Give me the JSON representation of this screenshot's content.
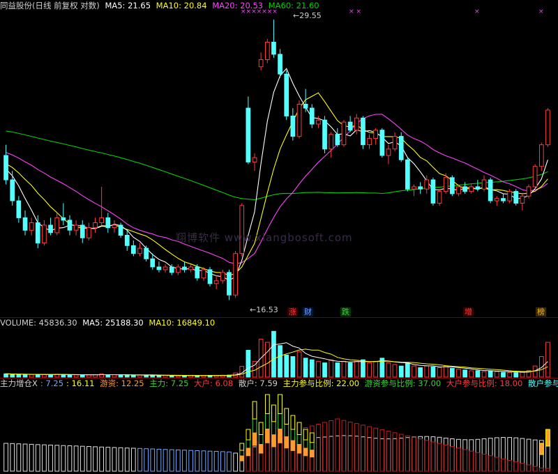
{
  "price_header": {
    "title": "同益股份(日线 前复权 对数)",
    "ma5": "MA5: 21.65",
    "ma10": "MA10: 20.84",
    "ma20": "MA20: 20.53",
    "ma60": "MA60: 21.60"
  },
  "price_labels": {
    "high": "29.55",
    "low": "16.53"
  },
  "x_marks": "×××××××",
  "event_markers": [
    {
      "text": "涨",
      "color": "#ff3b3b",
      "bg": "#3a0000"
    },
    {
      "text": "财",
      "color": "#6fa8ff",
      "bg": "#00153a"
    },
    {
      "text": "跌",
      "color": "#3bd13b",
      "bg": "#003a00"
    },
    {
      "text": "增",
      "color": "#ff3b3b",
      "bg": "#3a0000"
    },
    {
      "text": "榜",
      "color": "#ffb000",
      "bg": "#3a2a00"
    }
  ],
  "watermark": "翔博软件 www.xiangbosoft.com",
  "volume_header": {
    "volume": "VOLUME: 45836.30",
    "ma5": "MA5: 25188.30",
    "ma10": "MA10: 16849.10"
  },
  "flow_header": {
    "main_label": "主力增仓X",
    "v1": ": 7.25",
    "v2": ": 16.11",
    "youzi": "游资: 12.25",
    "zhuli": "主力: 7.25",
    "dahu": "大户: 6.08",
    "sanhu": "散户: 7.59",
    "zhuli_ratio": "主力参与比例: 22.00",
    "youzi_ratio": "游资参与比例: 37.00",
    "dahu_ratio": "大户参与比例: 18.00",
    "sanhu_ratio": "散户参与比例:"
  },
  "colors": {
    "up": "#ff3b3b",
    "down": "#54ffff",
    "ma5": "#ffffff",
    "ma10": "#ffff00",
    "ma20": "#ff40ff",
    "ma60": "#00d000",
    "grid": "#7a0000"
  },
  "chart_data": {
    "type": "candlestick",
    "title": "同益股份(日线 前复权 对数)",
    "price_range": [
      16.53,
      29.55
    ],
    "candles": [
      [
        22.3,
        22.8,
        21.0,
        21.2
      ],
      [
        21.2,
        21.6,
        20.1,
        20.3
      ],
      [
        20.3,
        20.5,
        19.4,
        19.6
      ],
      [
        19.6,
        19.9,
        18.9,
        19.1
      ],
      [
        19.1,
        19.6,
        18.9,
        19.4
      ],
      [
        19.4,
        19.7,
        18.4,
        18.6
      ],
      [
        18.6,
        19.5,
        18.5,
        19.3
      ],
      [
        19.3,
        19.6,
        18.9,
        19.0
      ],
      [
        19.0,
        19.8,
        18.9,
        19.6
      ],
      [
        19.6,
        20.2,
        19.3,
        19.5
      ],
      [
        19.5,
        19.7,
        18.9,
        19.1
      ],
      [
        19.1,
        19.5,
        18.9,
        19.3
      ],
      [
        19.3,
        19.5,
        18.6,
        18.8
      ],
      [
        18.8,
        19.4,
        18.7,
        19.2
      ],
      [
        19.2,
        19.6,
        19.0,
        19.4
      ],
      [
        19.4,
        20.9,
        19.3,
        19.6
      ],
      [
        19.6,
        19.8,
        19.0,
        19.2
      ],
      [
        19.2,
        19.5,
        19.0,
        19.3
      ],
      [
        19.3,
        19.4,
        18.8,
        18.9
      ],
      [
        18.9,
        19.1,
        18.3,
        18.5
      ],
      [
        18.5,
        18.7,
        18.1,
        18.2
      ],
      [
        18.2,
        18.6,
        18.1,
        18.4
      ],
      [
        18.4,
        18.5,
        17.9,
        18.0
      ],
      [
        18.0,
        18.2,
        17.6,
        17.7
      ],
      [
        17.7,
        17.9,
        17.5,
        17.6
      ],
      [
        17.6,
        17.8,
        17.5,
        17.7
      ],
      [
        17.7,
        17.8,
        17.4,
        17.5
      ],
      [
        17.5,
        17.8,
        17.4,
        17.7
      ],
      [
        17.7,
        17.9,
        17.5,
        17.6
      ],
      [
        17.6,
        17.8,
        17.5,
        17.7
      ],
      [
        17.7,
        17.8,
        17.2,
        17.3
      ],
      [
        17.3,
        17.7,
        17.2,
        17.6
      ],
      [
        17.6,
        17.7,
        17.0,
        17.1
      ],
      [
        17.1,
        17.4,
        16.9,
        17.2
      ],
      [
        17.2,
        17.6,
        17.1,
        17.5
      ],
      [
        17.5,
        17.6,
        16.53,
        16.7
      ],
      [
        16.7,
        18.3,
        16.6,
        18.2
      ],
      [
        18.2,
        20.2,
        18.1,
        20.1
      ],
      [
        24.6,
        25.2,
        21.9,
        22.0
      ],
      [
        22.0,
        22.4,
        21.6,
        22.2
      ],
      [
        26.8,
        27.6,
        26.6,
        27.2
      ],
      [
        27.2,
        28.4,
        27.0,
        28.2
      ],
      [
        28.2,
        29.55,
        27.3,
        27.5
      ],
      [
        27.5,
        27.8,
        26.2,
        26.4
      ],
      [
        26.4,
        26.6,
        24.0,
        24.2
      ],
      [
        24.2,
        24.6,
        23.0,
        23.2
      ],
      [
        23.2,
        25.0,
        23.1,
        24.8
      ],
      [
        24.8,
        25.6,
        24.4,
        24.6
      ],
      [
        24.6,
        24.8,
        23.6,
        23.8
      ],
      [
        23.8,
        24.2,
        23.6,
        24.0
      ],
      [
        24.0,
        24.2,
        22.4,
        22.6
      ],
      [
        22.6,
        23.4,
        22.2,
        23.3
      ],
      [
        23.3,
        23.6,
        22.7,
        22.8
      ],
      [
        22.8,
        24.0,
        22.7,
        23.9
      ],
      [
        23.9,
        24.2,
        23.4,
        23.5
      ],
      [
        23.5,
        24.3,
        23.3,
        24.1
      ],
      [
        24.1,
        24.2,
        22.6,
        22.8
      ],
      [
        22.8,
        23.3,
        22.6,
        23.1
      ],
      [
        23.1,
        23.6,
        22.8,
        23.5
      ],
      [
        23.5,
        23.6,
        22.2,
        22.3
      ],
      [
        22.3,
        22.8,
        21.9,
        22.6
      ],
      [
        22.6,
        23.4,
        22.5,
        23.2
      ],
      [
        23.2,
        23.4,
        22.0,
        22.1
      ],
      [
        22.1,
        22.2,
        20.7,
        20.8
      ],
      [
        20.8,
        21.0,
        20.5,
        20.9
      ],
      [
        20.9,
        21.1,
        20.6,
        20.8
      ],
      [
        20.8,
        21.4,
        20.6,
        21.2
      ],
      [
        21.2,
        21.3,
        20.1,
        20.2
      ],
      [
        20.2,
        20.8,
        20.1,
        20.7
      ],
      [
        20.7,
        21.5,
        20.6,
        21.3
      ],
      [
        21.3,
        21.4,
        20.5,
        20.6
      ],
      [
        20.6,
        21.0,
        20.5,
        20.9
      ],
      [
        20.9,
        21.1,
        20.6,
        20.7
      ],
      [
        20.7,
        21.0,
        20.6,
        20.9
      ],
      [
        20.9,
        21.2,
        20.7,
        20.8
      ],
      [
        20.8,
        21.4,
        20.7,
        21.2
      ],
      [
        21.2,
        21.3,
        20.2,
        20.3
      ],
      [
        20.3,
        20.5,
        20.1,
        20.4
      ],
      [
        20.4,
        20.6,
        20.2,
        20.3
      ],
      [
        20.3,
        20.8,
        20.2,
        20.7
      ],
      [
        20.7,
        20.8,
        20.1,
        20.2
      ],
      [
        20.2,
        20.6,
        19.9,
        20.5
      ],
      [
        20.5,
        21.0,
        20.4,
        20.9
      ],
      [
        20.9,
        21.9,
        20.8,
        21.8
      ],
      [
        21.8,
        22.9,
        21.6,
        22.8
      ],
      [
        22.8,
        24.6,
        22.7,
        24.5
      ]
    ],
    "ma_series": [
      "MA5",
      "MA10",
      "MA20",
      "MA60"
    ],
    "volume": [
      2100,
      1900,
      1700,
      1600,
      1500,
      1700,
      1600,
      1500,
      1800,
      1600,
      1500,
      1400,
      1300,
      1400,
      1500,
      2000,
      1500,
      1400,
      1300,
      1400,
      1200,
      1300,
      1200,
      1100,
      1000,
      1100,
      1000,
      900,
      1000,
      1100,
      900,
      1000,
      1100,
      1000,
      1200,
      1300,
      2600,
      6800,
      17000,
      10000,
      24000,
      22000,
      29000,
      20000,
      14000,
      13000,
      16000,
      12000,
      11000,
      10000,
      9000,
      11000,
      9000,
      10000,
      9000,
      10000,
      11000,
      9000,
      10000,
      12000,
      9000,
      8000,
      7000,
      9000,
      7000,
      6000,
      7000,
      6500,
      6000,
      7000,
      5500,
      5000,
      4500,
      4000,
      4000,
      3500,
      4000,
      3500,
      3000,
      3000,
      2800,
      3200,
      4200,
      7000,
      13000,
      22000
    ]
  }
}
